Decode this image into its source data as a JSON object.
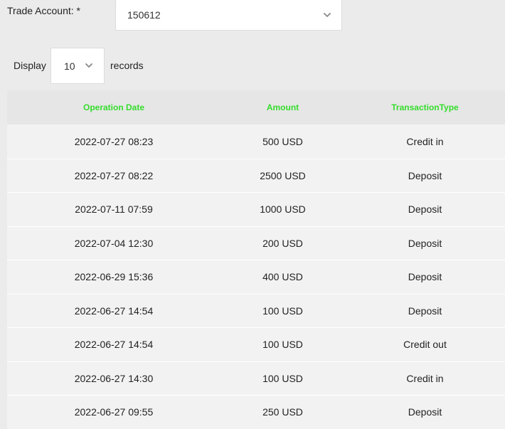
{
  "account": {
    "label": "Trade Account: *",
    "selected": "150612"
  },
  "page_size": {
    "prefix": "Display",
    "selected": "10",
    "suffix": "records"
  },
  "table": {
    "headers": [
      "Operation Date",
      "Amount",
      "TransactionType"
    ],
    "rows": [
      [
        "2022-07-27 08:23",
        "500 USD",
        "Credit in"
      ],
      [
        "2022-07-27 08:22",
        "2500 USD",
        "Deposit"
      ],
      [
        "2022-07-11 07:59",
        "1000 USD",
        "Deposit"
      ],
      [
        "2022-07-04 12:30",
        "200 USD",
        "Deposit"
      ],
      [
        "2022-06-29 15:36",
        "400 USD",
        "Deposit"
      ],
      [
        "2022-06-27 14:54",
        "100 USD",
        "Deposit"
      ],
      [
        "2022-06-27 14:54",
        "100 USD",
        "Credit out"
      ],
      [
        "2022-06-27 14:30",
        "100 USD",
        "Credit in"
      ],
      [
        "2022-06-27 09:55",
        "250 USD",
        "Deposit"
      ]
    ]
  },
  "colors": {
    "header_text": "#35dd2c",
    "background": "#ebebeb"
  },
  "icons": {
    "dropdown": "chevron-down-icon"
  }
}
